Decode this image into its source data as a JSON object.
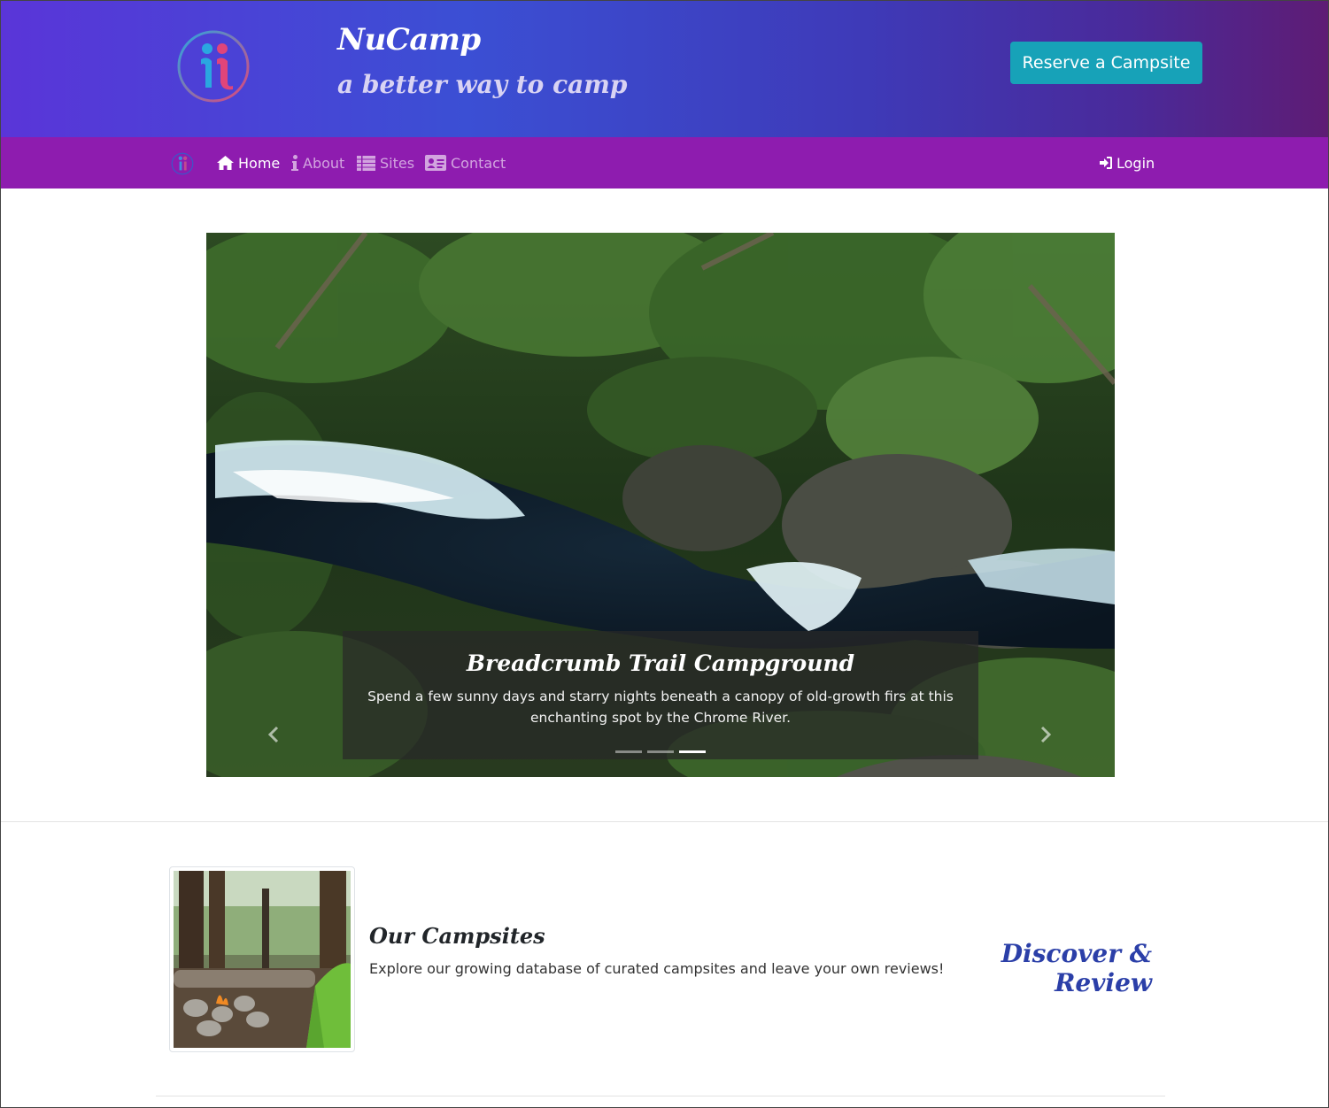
{
  "header": {
    "brand_title": "NuCamp",
    "brand_subtitle": "a better way to camp",
    "reserve_label": "Reserve a Campsite",
    "logo_icon": "nucamp-logo-icon"
  },
  "nav": {
    "items": [
      {
        "label": "Home",
        "icon": "home-icon",
        "active": true
      },
      {
        "label": "About",
        "icon": "info-icon",
        "active": false
      },
      {
        "label": "Sites",
        "icon": "list-icon",
        "active": false
      },
      {
        "label": "Contact",
        "icon": "address-card-icon",
        "active": false
      }
    ],
    "login_label": "Login",
    "login_icon": "sign-in-icon"
  },
  "carousel": {
    "caption_title": "Breadcrumb Trail Campground",
    "caption_text": "Spend a few sunny days and starry nights beneath a canopy of old-growth firs at this enchanting spot by the Chrome River.",
    "slide_count": 3,
    "active_slide": 3,
    "prev_icon": "chevron-left-icon",
    "next_icon": "chevron-right-icon"
  },
  "media": {
    "title": "Our Campsites",
    "text": "Explore our growing database of curated campsites and leave your own reviews!",
    "tagline": "Discover & Review"
  },
  "colors": {
    "header_gradient_start": "#5a35d8",
    "header_gradient_end": "#5e1c74",
    "navbar": "#8e1caf",
    "button": "#17a2b8",
    "tagline": "#2b3fa8"
  }
}
